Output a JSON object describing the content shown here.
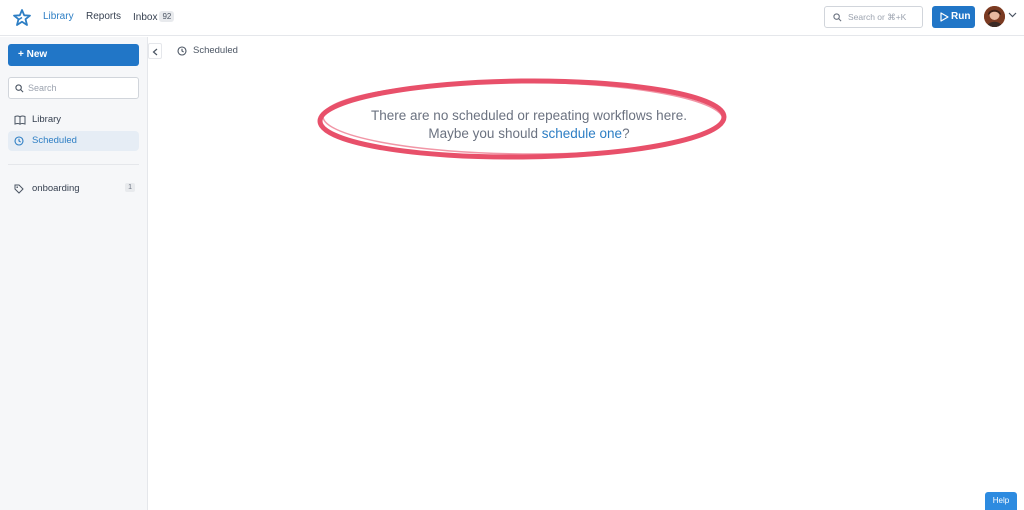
{
  "nav": {
    "library": "Library",
    "reports": "Reports",
    "inbox": "Inbox",
    "inbox_count": "92"
  },
  "top_search": {
    "placeholder": "Search or ⌘+K"
  },
  "run_button": "Run",
  "sidebar": {
    "new_button": "+ New",
    "search_placeholder": "Search",
    "items": [
      {
        "label": "Library",
        "icon": "book-icon"
      },
      {
        "label": "Scheduled",
        "icon": "clock-icon",
        "active": true
      }
    ],
    "tags": [
      {
        "label": "onboarding",
        "count": "1",
        "icon": "tag-icon"
      }
    ]
  },
  "breadcrumb": {
    "label": "Scheduled"
  },
  "empty_state": {
    "line1": "There are no scheduled or repeating workflows here.",
    "line2_prefix": "Maybe you should ",
    "link": "schedule one",
    "line2_suffix": "?"
  },
  "help_button": "Help",
  "colors": {
    "accent": "#2176c7",
    "link": "#2d7ec4",
    "annotation": "#e8506a"
  }
}
